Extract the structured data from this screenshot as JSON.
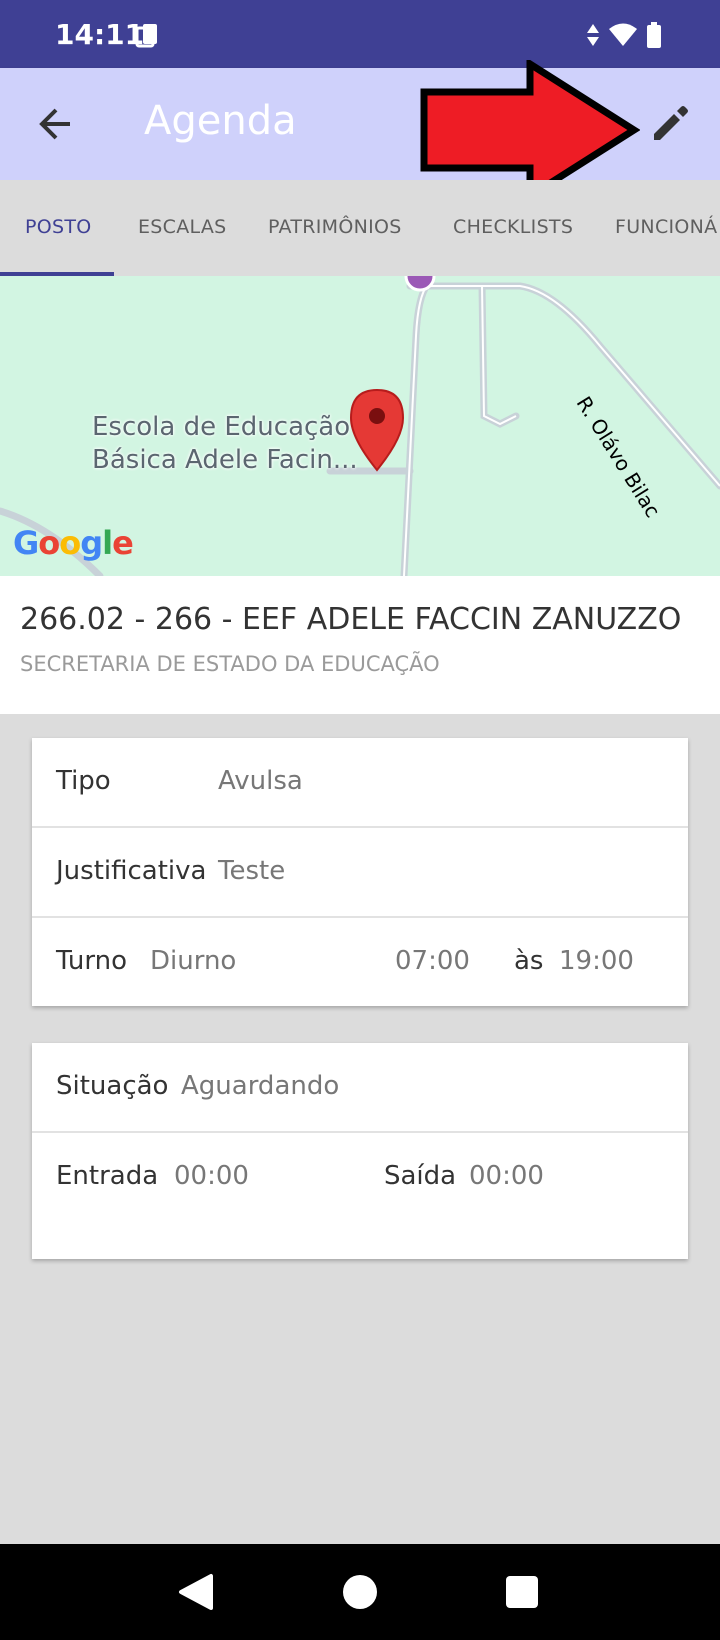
{
  "status_bar": {
    "time": "14:11"
  },
  "app_bar": {
    "title": "Agenda"
  },
  "tabs": [
    {
      "label": "POSTO"
    },
    {
      "label": "ESCALAS"
    },
    {
      "label": "PATRIMÔNIOS"
    },
    {
      "label": "CHECKLISTS"
    },
    {
      "label": "FUNCIONÁ"
    }
  ],
  "map": {
    "place_label_line1": "Escola de Educação",
    "place_label_line2": "Básica Adele Facin...",
    "street_label": "R. Olávo Bilac",
    "google_logo": "Google"
  },
  "post": {
    "title": "266.02 - 266 - EEF ADELE FACCIN ZANUZZO",
    "subtitle": "SECRETARIA DE ESTADO DA EDUCAÇÃO"
  },
  "details": {
    "tipo_label": "Tipo",
    "tipo_value": "Avulsa",
    "justificativa_label": "Justificativa",
    "justificativa_value": "Teste",
    "turno_label": "Turno",
    "turno_value": "Diurno",
    "start_time": "07:00",
    "as_label": "às",
    "end_time": "19:00"
  },
  "status": {
    "situacao_label": "Situação",
    "situacao_value": "Aguardando",
    "entrada_label": "Entrada",
    "entrada_value": "00:00",
    "saida_label": "Saída",
    "saida_value": "00:00"
  },
  "colors": {
    "primary": "#3f4094",
    "app_bar": "#cfd1fb",
    "map_bg": "#d2f5e2",
    "arrow": "#ee1c25",
    "pin": "#e53935"
  },
  "icons": [
    "back-arrow-icon",
    "pencil-icon",
    "map-pin-icon",
    "nav-back-icon",
    "nav-home-icon",
    "nav-recents-icon"
  ]
}
